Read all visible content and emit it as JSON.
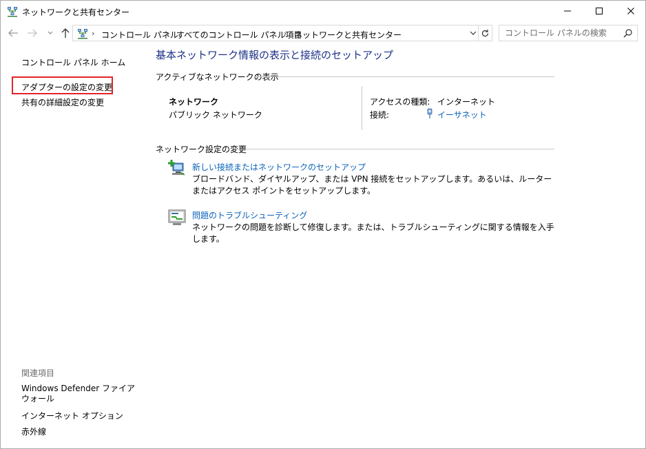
{
  "window": {
    "title": "ネットワークと共有センター",
    "controls": {
      "minimize": "minimize",
      "maximize": "maximize",
      "close": "close"
    }
  },
  "address_bar": {
    "breadcrumbs": [
      "コントロール パネル",
      "すべてのコントロール パネル項目",
      "ネットワークと共有センター"
    ],
    "search_placeholder": "コントロール パネルの検索"
  },
  "sidebar": {
    "home": "コントロール パネル ホーム",
    "links": [
      "アダプターの設定の変更",
      "共有の詳細設定の変更"
    ],
    "related_heading": "関連項目",
    "related": [
      "Windows Defender ファイアウォール",
      "インターネット オプション",
      "赤外線"
    ]
  },
  "main": {
    "title": "基本ネットワーク情報の表示と接続のセットアップ",
    "active_section": "アクティブなネットワークの表示",
    "network": {
      "name": "ネットワーク",
      "type": "パブリック ネットワーク",
      "access_label": "アクセスの種類:",
      "access_value": "インターネット",
      "connection_label": "接続:",
      "connection_value": "イーサネット"
    },
    "settings_section": "ネットワーク設定の変更",
    "tasks": [
      {
        "title": "新しい接続またはネットワークのセットアップ",
        "desc": "ブロードバンド、ダイヤルアップ、または VPN 接続をセットアップします。あるいは、ルーターまたはアクセス ポイントをセットアップします。",
        "icon": "new-connection-icon"
      },
      {
        "title": "問題のトラブルシューティング",
        "desc": "ネットワークの問題を診断して修復します。または、トラブルシューティングに関する情報を入手します。",
        "icon": "troubleshoot-icon"
      }
    ]
  },
  "colors": {
    "accent_title": "#1e3287",
    "link": "#0a62b8",
    "highlight": "#e0242a"
  }
}
